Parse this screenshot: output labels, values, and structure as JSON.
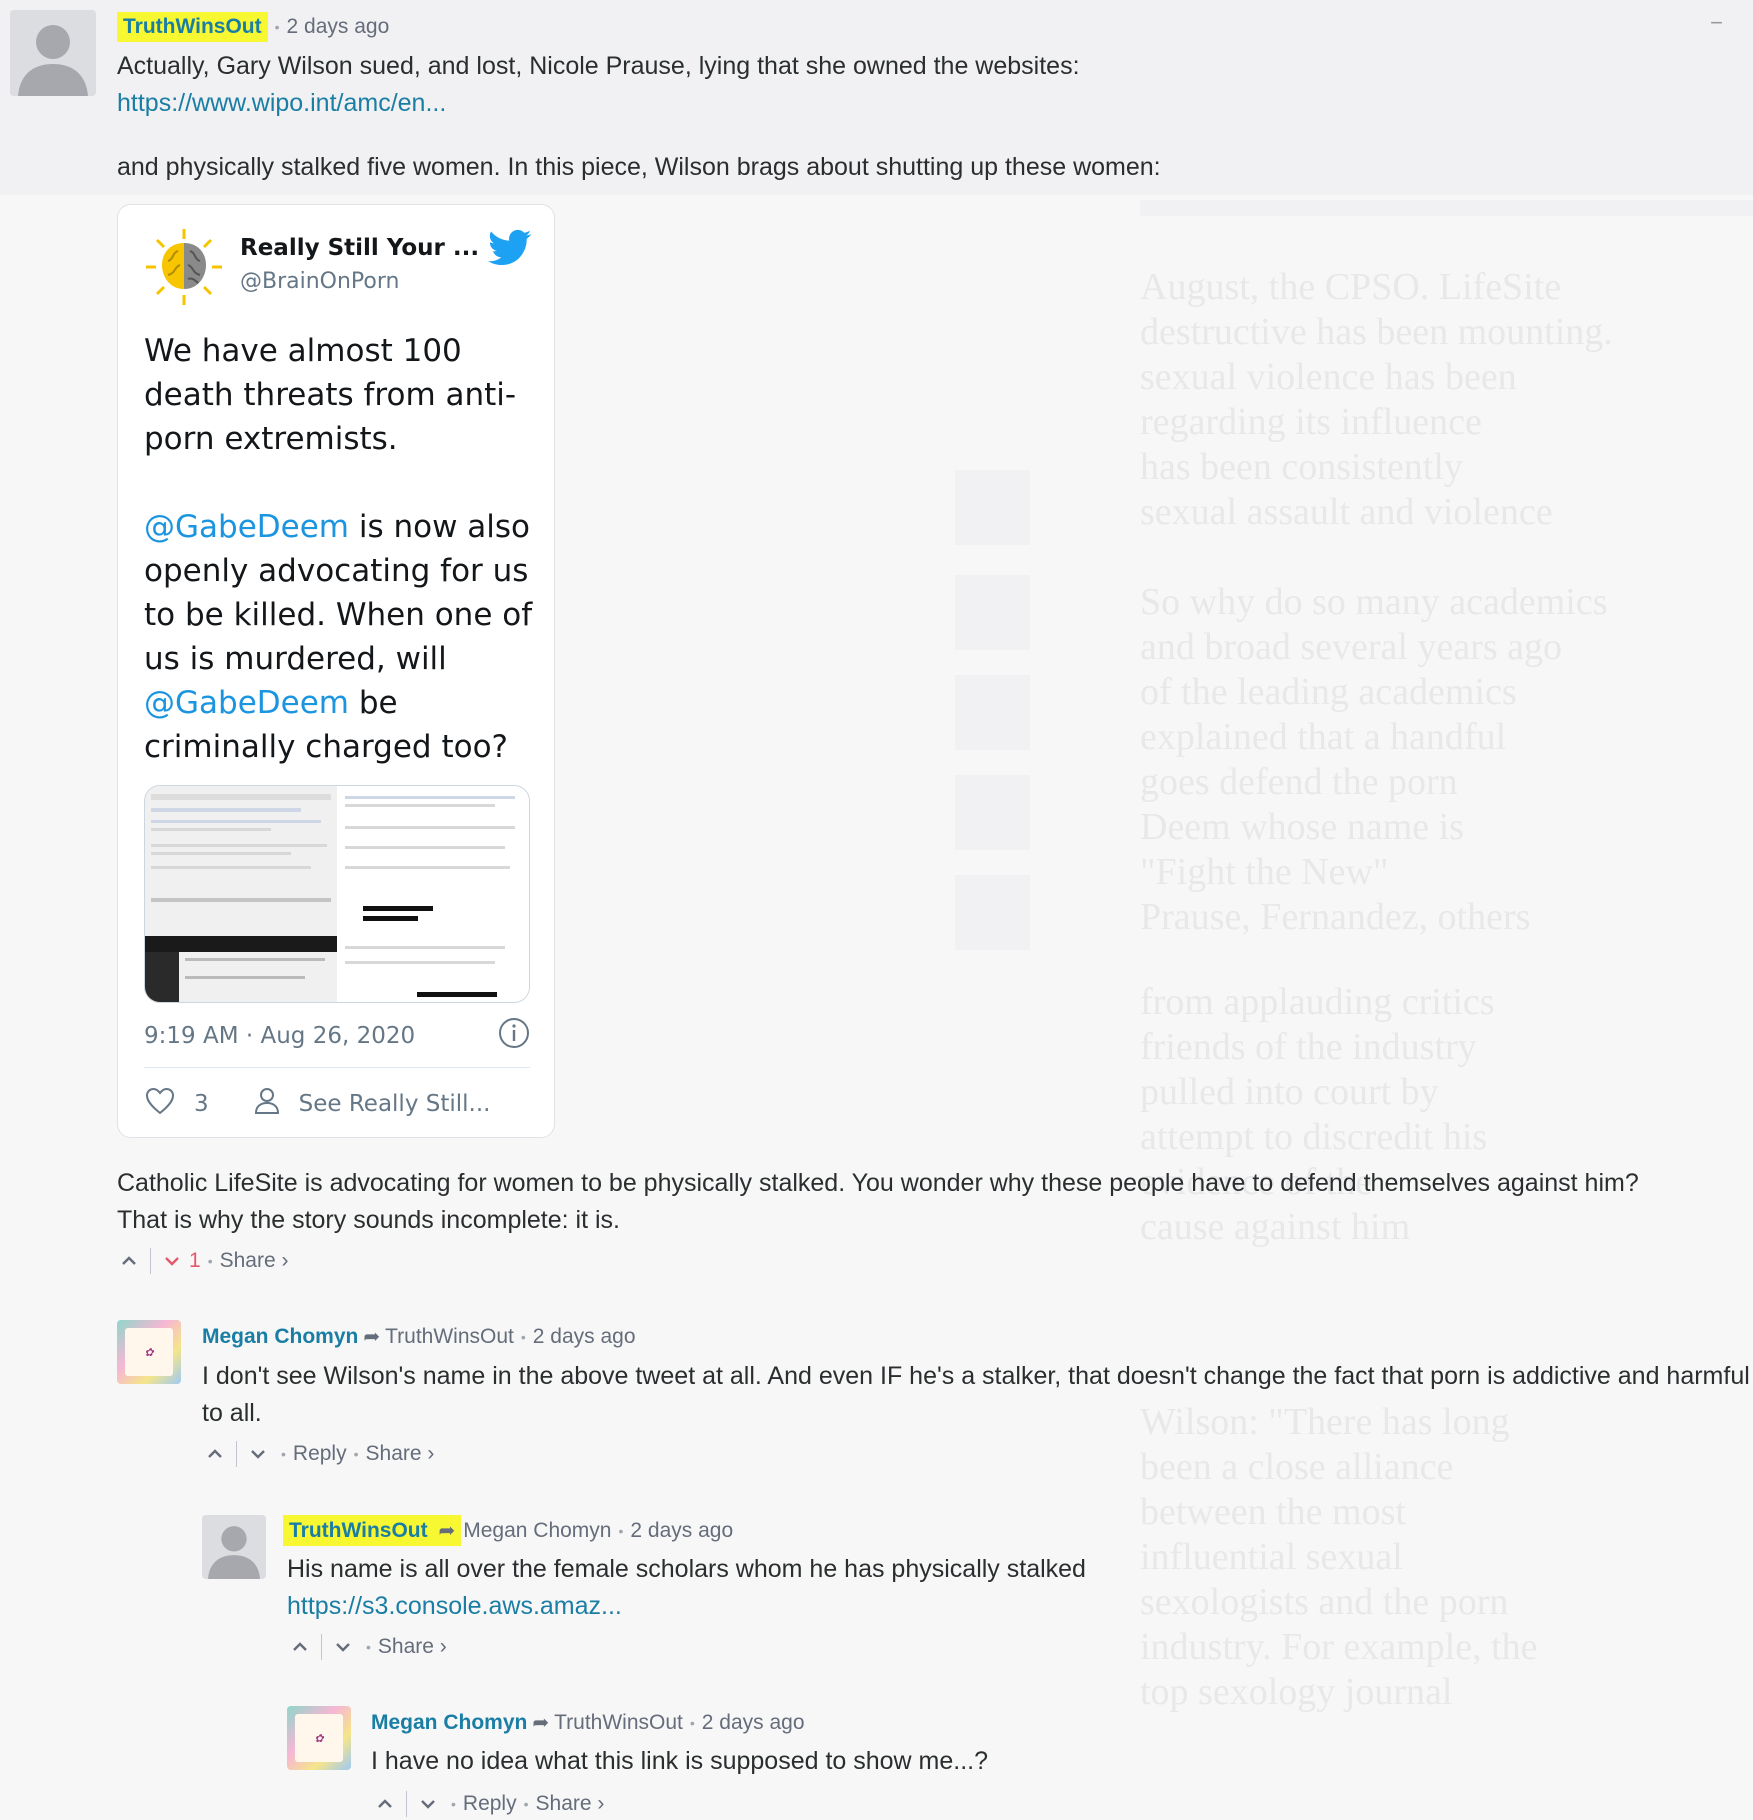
{
  "thread": {
    "collapse": "−",
    "c1": {
      "author": "TruthWinsOut",
      "time": "2 days ago",
      "line1": "Actually, Gary Wilson sued, and lost, Nicole Prause, lying that she owned the websites:",
      "link": "https://www.wipo.int/amc/en...",
      "line2": "and physically stalked five women. In this piece, Wilson brags about shutting up these women:",
      "line3": "Catholic LifeSite is advocating for women to be physically stalked. You wonder why these people have to defend themselves against him?",
      "line4": "That is why the story sounds incomplete: it is.",
      "downvotes": "1",
      "share": "Share ›"
    },
    "tweet": {
      "name": "Really Still Your ...",
      "handle": "@BrainOnPorn",
      "text_a": "We have almost 100 death threats from anti-porn extremists.",
      "mention1": "@GabeDeem",
      "text_b": " is now also openly advocating for us to be killed. When one of us is murdered, will ",
      "mention2": "@GabeDeem",
      "text_c": " be criminally charged too?",
      "timestamp": "9:19 AM · Aug 26, 2020",
      "likes": "3",
      "see_more": "See Really Still..."
    },
    "c2": {
      "author": "Megan Chomyn",
      "reply_to": "TruthWinsOut",
      "time": "2 days ago",
      "text": "I don't see Wilson's name in the above tweet at all. And even IF he's a stalker, that doesn't change the fact that porn is addictive and harmful to all.",
      "reply": "Reply",
      "share": "Share ›"
    },
    "c3": {
      "author": "TruthWinsOut",
      "reply_to": "Megan Chomyn",
      "time": "2 days ago",
      "text": "His name is all over the female scholars whom he has physically stalked",
      "link": "https://s3.console.aws.amaz...",
      "share": "Share ›"
    },
    "c4": {
      "author": "Megan Chomyn",
      "reply_to": "TruthWinsOut",
      "time": "2 days ago",
      "text": "I have no idea what this link is supposed to show me...?",
      "reply": "Reply",
      "share": "Share ›"
    }
  },
  "colors": {
    "highlight": "#f7f732",
    "author_blue": "#1a7ea4",
    "downvote_red": "#e5586b",
    "twitter_blue": "#1da1f2"
  },
  "icons": [
    "user-silhouette-icon",
    "megan-avatar-icon",
    "upvote-chevron-icon",
    "downvote-chevron-icon",
    "reply-arrow-icon",
    "twitter-bird-icon",
    "heart-icon",
    "person-icon",
    "info-icon",
    "brain-logo-icon"
  ]
}
